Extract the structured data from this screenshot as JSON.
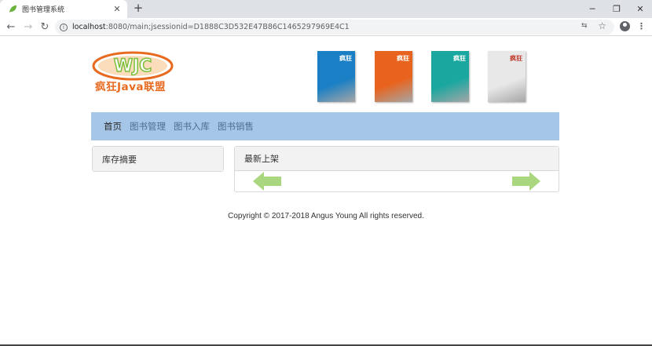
{
  "browser": {
    "tab_title": "图书管理系统",
    "url_host": "localhost",
    "url_rest": ":8080/main;jsessionid=D1888C3D532E47B86C1465297969E4C1"
  },
  "logo": {
    "emblem_text": "WJC",
    "caption": "疯狂Java联盟"
  },
  "books": [
    {
      "title": "疯狂",
      "color": "#1a7fc4"
    },
    {
      "title": "疯狂",
      "color": "#e8641e"
    },
    {
      "title": "疯狂",
      "color": "#1aa7a0"
    },
    {
      "title": "疯狂",
      "color": "#e8e8e8"
    }
  ],
  "nav": {
    "items": [
      "首页",
      "图书管理",
      "图书入库",
      "图书销售"
    ]
  },
  "inventory_panel": {
    "title": "库存摘要"
  },
  "new_arrivals_panel": {
    "title": "最新上架"
  },
  "footer": {
    "text": "Copyright © 2017-2018 Angus Young All rights reserved."
  },
  "colors": {
    "nav_bg": "#a5c6e6",
    "logo_orange": "#e86a1f",
    "arrow_green": "#a9d67e"
  }
}
